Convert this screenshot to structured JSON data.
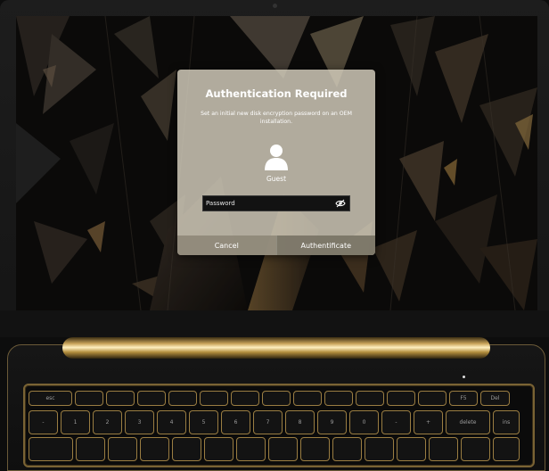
{
  "dialog": {
    "title": "Authentication Required",
    "message": "Set an initial new disk encryption password on an OEM installation.",
    "user_name": "Guest",
    "password_placeholder": "Password",
    "password_value": "",
    "cancel_label": "Cancel",
    "authenticate_label": "Authentificate"
  },
  "icons": {
    "avatar": "user-avatar-icon",
    "reveal": "eye-slash-icon"
  },
  "keyboard": {
    "row1": [
      "esc",
      "",
      "",
      "",
      "",
      "",
      "",
      "",
      "",
      "",
      "",
      "",
      "",
      "F5",
      "Del"
    ],
    "row2": [
      "-",
      "1",
      "2",
      "3",
      "4",
      "5",
      "6",
      "7",
      "8",
      "9",
      "0",
      "-",
      "+",
      "delete",
      "ins"
    ]
  },
  "colors": {
    "accent_gold": "#c9a45a",
    "dialog_bg": "#d6d0be"
  }
}
